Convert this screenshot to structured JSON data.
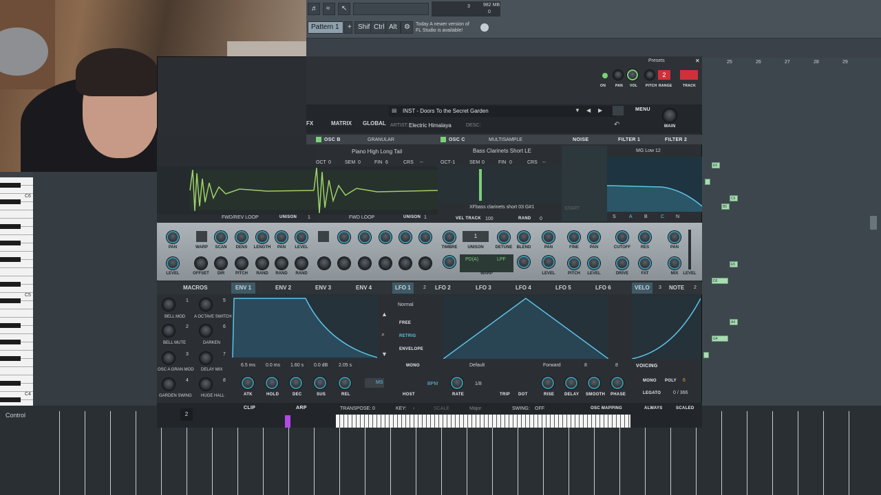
{
  "fl": {
    "pattern_label": "Pattern 1",
    "pattern_add": "+",
    "mod_keys": [
      "Shift",
      "Ctrl",
      "Alt"
    ],
    "memory": "982 MB",
    "cpu_value": "3",
    "cpu_extra": "0",
    "hint_line1": "Today  A newer version of",
    "hint_line2": "FL Studio is available!",
    "control_label": "Control",
    "bar_numbers": [
      "25",
      "26",
      "27",
      "28",
      "29"
    ],
    "piano_labels": [
      "C6",
      "C5",
      "C4"
    ],
    "notes": [
      "E6",
      "C6",
      "B5",
      "E5",
      "D5",
      "A4",
      "G4"
    ]
  },
  "serum": {
    "presets_label": "Presets",
    "tabs": [
      "FX",
      "MATRIX",
      "GLOBAL"
    ],
    "preset_name": "INST - Doors To the Secret Garden",
    "artist_label": "ARTIST:",
    "artist": "Electric Himalaya",
    "desc_label": "DESC:",
    "menu_label": "MENU",
    "main_label": "MAIN",
    "top_knobs": [
      "ON",
      "PAN",
      "VOL",
      "PITCH",
      "RANGE",
      "TRACK"
    ],
    "range_value": "2",
    "osc_b": {
      "title": "OSC B",
      "mode": "GRANULAR",
      "sample": "Piano High Long Tail",
      "oct_label": "OCT",
      "oct": "0",
      "sem_label": "SEM",
      "sem": "0",
      "fin_label": "FIN",
      "fin": "6",
      "crs_label": "CRS",
      "crs": "--",
      "loop": "FWD/REV LOOP",
      "unison_label": "UNISON",
      "unison": "1"
    },
    "osc_c": {
      "title": "OSC C",
      "mode": "MULTISAMPLE",
      "sample": "Bass Clarinets Short LE",
      "oct_label": "OCT",
      "oct": "-1",
      "sem_label": "SEM",
      "sem": "0",
      "fin_label": "FIN",
      "fin": "0",
      "crs_label": "CRS",
      "crs": "--",
      "loop": "FWD LOOP",
      "unison_label": "UNISON",
      "unison": "1",
      "sample_file": "XFbass clarinets short 03 G#1",
      "vel_track_label": "VEL TRACK",
      "vel_track": "100",
      "rand_label": "RAND",
      "rand": "0"
    },
    "noise_title": "NOISE",
    "noise_start": "START",
    "filter_tabs": [
      "FILTER 1",
      "FILTER 2"
    ],
    "filter_type": "MG Low 12",
    "filter_routes": [
      "S",
      "A",
      "B",
      "C",
      "N"
    ],
    "osc_b_knobs_top": [
      "PAN",
      "WARP",
      "SCAN",
      "DENS",
      "LENGTH",
      "PAN",
      "LEVEL"
    ],
    "osc_b_knobs_bot": [
      "LEVEL",
      "OFFSET",
      "DIR",
      "PITCH",
      "RAND",
      "RAND",
      "RAND"
    ],
    "osc_c_knobs_top": [
      "TIMBRE",
      "UNISON",
      "DETUNE",
      "BLEND",
      "PAN"
    ],
    "osc_c_knobs_bot": [
      "WARP",
      "LEVEL"
    ],
    "osc_c_unison": "1",
    "osc_c_warp_a": "PD(A)",
    "osc_c_warp_b": "LPF",
    "noise_knobs_top": [
      "FINE",
      "PAN"
    ],
    "noise_knobs_bot": [
      "PITCH",
      "LEVEL"
    ],
    "filter_knobs_top": [
      "CUTOFF",
      "RES",
      "PAN"
    ],
    "filter_knobs_bot": [
      "DRIVE",
      "FAT",
      "MIX",
      "LEVEL"
    ],
    "mod_tabs": [
      "MACROS",
      "ENV 1",
      "ENV 2",
      "ENV 3",
      "ENV 4",
      "LFO 1",
      "LFO 2",
      "LFO 3",
      "LFO 4",
      "LFO 5",
      "LFO 6",
      "VELO",
      "NOTE"
    ],
    "lfo1_count": "2",
    "velo_count": "3",
    "note_count": "2",
    "macros": [
      {
        "num": "1",
        "label": "BELL MOD"
      },
      {
        "num": "5",
        "label": "A OCTAVE SWITCH"
      },
      {
        "num": "2",
        "label": "BELL MUTE"
      },
      {
        "num": "6",
        "label": "DARKEN"
      },
      {
        "num": "3",
        "label": "OSC A GRAN MOD"
      },
      {
        "num": "7",
        "label": "DELAY MIX"
      },
      {
        "num": "4",
        "label": "GARDEN SWING"
      },
      {
        "num": "8",
        "label": "HUGE HALL"
      }
    ],
    "env_values": [
      "6.5 ms",
      "0.0 ms",
      "1.60 s",
      "0.0 dB",
      "2.05 s"
    ],
    "env_knobs": [
      "ATK",
      "HOLD",
      "DEC",
      "SUS",
      "REL"
    ],
    "ms_label": "MS",
    "lfo_mode": "Normal",
    "lfo_options": [
      "FREE",
      "RETRIG",
      "ENVELOPE"
    ],
    "mono_label": "MONO",
    "lfo_preset": "Default",
    "lfo_dir": "Forward",
    "lfo_grid_a": "8",
    "lfo_grid_b": "8",
    "bpm_label": "BPM",
    "rate_value": "1/8",
    "lfo_knobs": [
      "HOST",
      "RATE",
      "TRIP",
      "DOT",
      "RISE",
      "DELAY",
      "SMOOTH",
      "PHASE"
    ],
    "voicing_title": "VOICING",
    "voicing_mono": "MONO",
    "voicing_poly": "POLY",
    "poly_value": "6",
    "legato_label": "LEGATO",
    "legato_value": "0 / 366",
    "bottom": {
      "clip": "CLIP",
      "arp": "ARP",
      "transpose_label": "TRANSPOSE:",
      "transpose": "0",
      "key_label": "KEY:",
      "key": "-",
      "scale_label": "SCALE",
      "scale": "Major",
      "swing_label": "SWING:",
      "swing": "OFF",
      "osc_mapping": "OSC MAPPING",
      "always": "ALWAYS",
      "scaled": "SCALED",
      "pitch_range": "2"
    }
  },
  "colors": {
    "accent": "#3aa8c8",
    "panel": "#2b2f33",
    "knob_panel": "#9aa2a7",
    "active": "#7cd07a",
    "red": "#d0303a"
  }
}
